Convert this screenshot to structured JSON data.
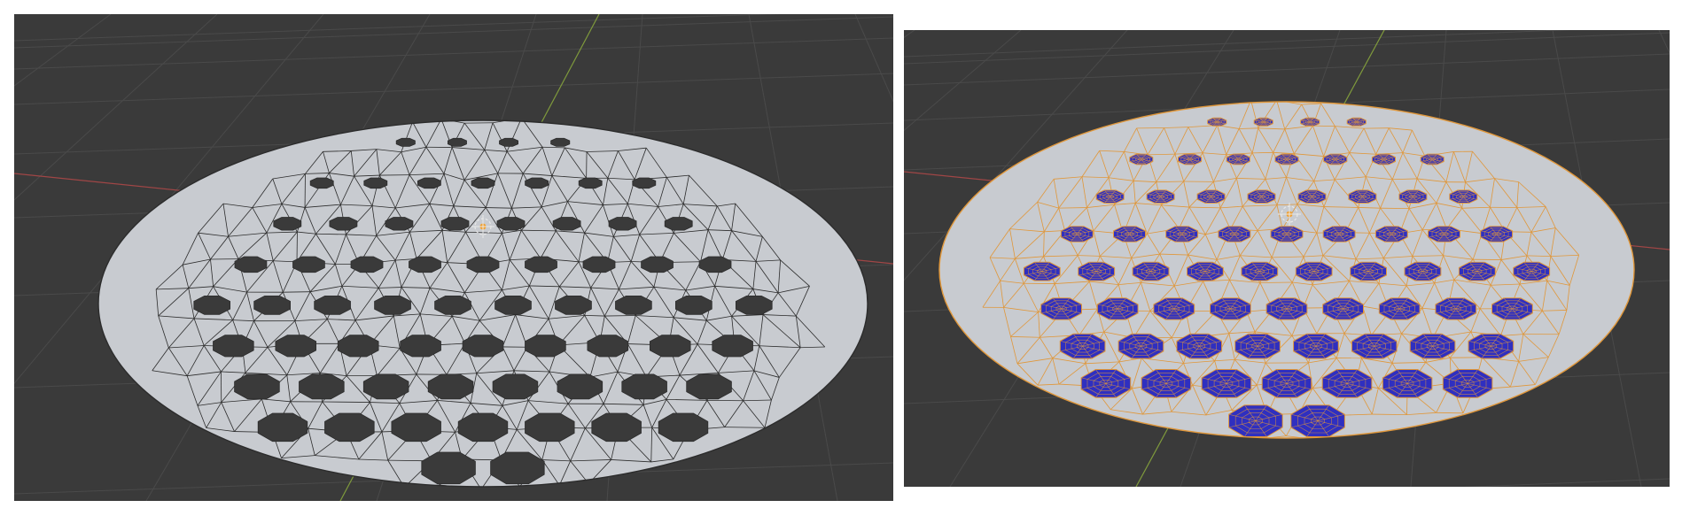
{
  "viewports": [
    {
      "id": "left",
      "mode": "object",
      "background_color": "#3a3a3a",
      "grid_color": "#4a4a4a",
      "x_axis_color": "#a04646",
      "y_axis_color": "#7f9a3c",
      "disc_color": "#c8cbd0",
      "edge_color": "#2c2c2c",
      "hole_color": "#3a3a3a",
      "origin_icon": "object-origin-icon"
    },
    {
      "id": "right",
      "mode": "edit",
      "background_color": "#3a3a3a",
      "grid_color": "#4a4a4a",
      "x_axis_color": "#a04646",
      "y_axis_color": "#7f9a3c",
      "disc_color": "#c8cbd0",
      "edge_color": "#e0973a",
      "selected_face_color": "#2f2fc0",
      "origin_icon": "object-origin-icon"
    }
  ]
}
